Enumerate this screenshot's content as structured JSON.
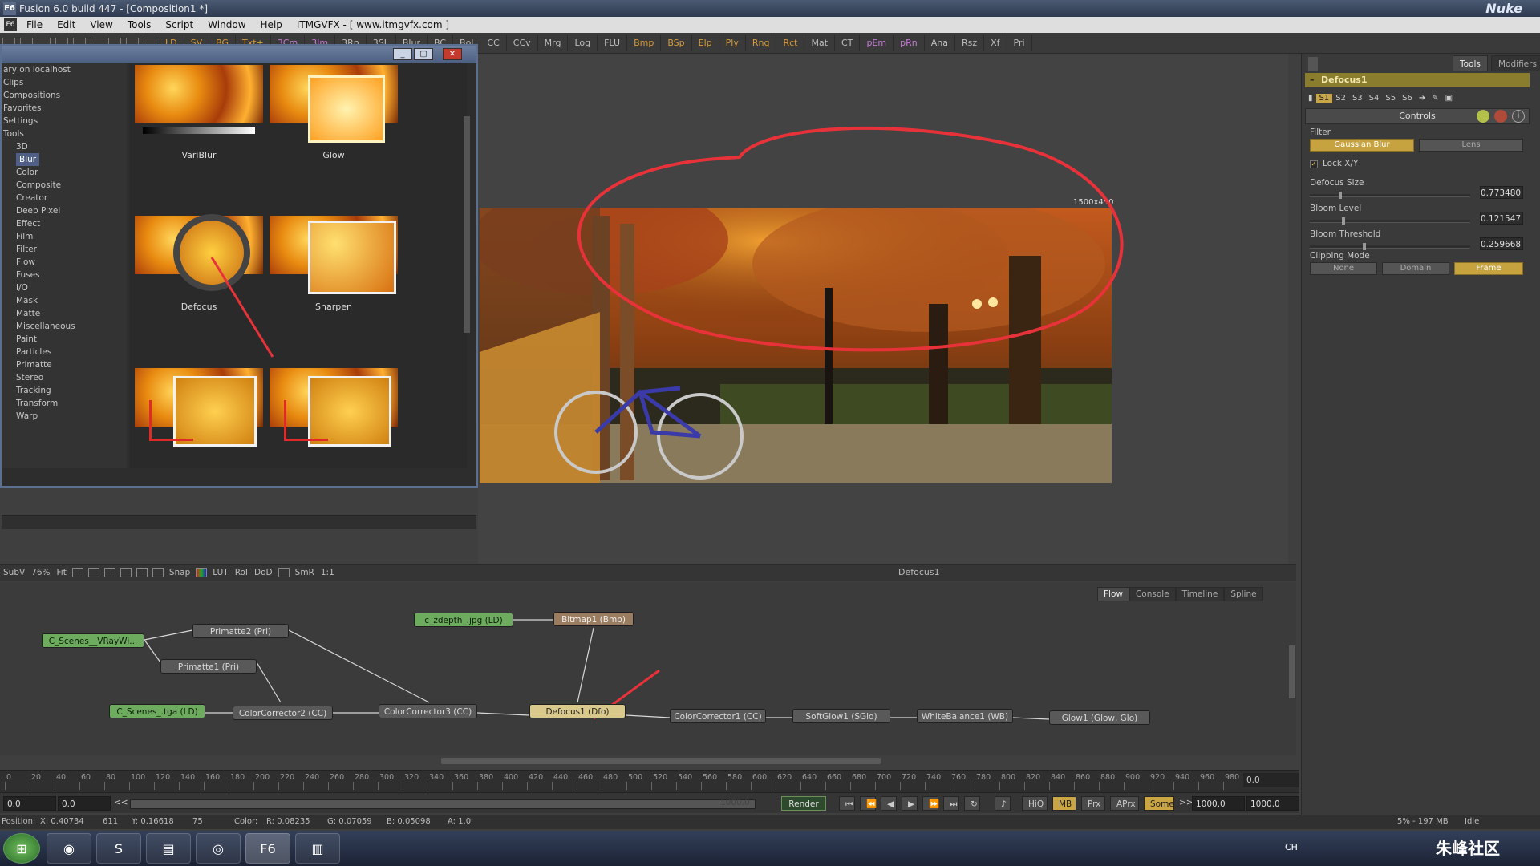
{
  "window": {
    "title": "Fusion 6.0 build 447 - [Composition1 *]",
    "app_icon": "F6",
    "logo_text": "Nuke"
  },
  "menu": {
    "icon": "F6",
    "items": [
      "File",
      "Edit",
      "View",
      "Tools",
      "Script",
      "Window",
      "Help",
      "ITMGVFX - [ www.itmgvfx.com ]"
    ]
  },
  "toolbar": {
    "buttons": [
      {
        "label": "LD",
        "color": "y"
      },
      {
        "label": "SV",
        "color": "y"
      },
      {
        "label": "BG",
        "color": "y"
      },
      {
        "label": "Txt+",
        "color": "y"
      },
      {
        "label": "3Cm",
        "color": "p"
      },
      {
        "label": "3Im",
        "color": "p"
      },
      {
        "label": "3Rn",
        "color": ""
      },
      {
        "label": "3SL",
        "color": ""
      },
      {
        "label": "Blur",
        "color": ""
      },
      {
        "label": "BC",
        "color": ""
      },
      {
        "label": "Bol",
        "color": ""
      },
      {
        "label": "CC",
        "color": ""
      },
      {
        "label": "CCv",
        "color": ""
      },
      {
        "label": "Mrg",
        "color": ""
      },
      {
        "label": "Log",
        "color": ""
      },
      {
        "label": "FLU",
        "color": ""
      },
      {
        "label": "Bmp",
        "color": "y"
      },
      {
        "label": "BSp",
        "color": "y"
      },
      {
        "label": "Elp",
        "color": "y"
      },
      {
        "label": "Ply",
        "color": "y"
      },
      {
        "label": "Rng",
        "color": "y"
      },
      {
        "label": "Rct",
        "color": "y"
      },
      {
        "label": "Mat",
        "color": ""
      },
      {
        "label": "CT",
        "color": ""
      },
      {
        "label": "pEm",
        "color": "p"
      },
      {
        "label": "pRn",
        "color": "p"
      },
      {
        "label": "Ana",
        "color": ""
      },
      {
        "label": "Rsz",
        "color": ""
      },
      {
        "label": "Xf",
        "color": ""
      },
      {
        "label": "Pri",
        "color": ""
      }
    ]
  },
  "bin": {
    "tree": [
      {
        "label": "ary on localhost",
        "indent": 0,
        "selected": false
      },
      {
        "label": "Clips",
        "indent": 0,
        "selected": false
      },
      {
        "label": "Compositions",
        "indent": 0,
        "selected": false
      },
      {
        "label": "Favorites",
        "indent": 0,
        "selected": false
      },
      {
        "label": "Settings",
        "indent": 0,
        "selected": false
      },
      {
        "label": "Tools",
        "indent": 0,
        "selected": false
      },
      {
        "label": "3D",
        "indent": 1,
        "selected": false
      },
      {
        "label": "Blur",
        "indent": 1,
        "selected": true
      },
      {
        "label": "Color",
        "indent": 1,
        "selected": false
      },
      {
        "label": "Composite",
        "indent": 1,
        "selected": false
      },
      {
        "label": "Creator",
        "indent": 1,
        "selected": false
      },
      {
        "label": "Deep Pixel",
        "indent": 1,
        "selected": false
      },
      {
        "label": "Effect",
        "indent": 1,
        "selected": false
      },
      {
        "label": "Film",
        "indent": 1,
        "selected": false
      },
      {
        "label": "Filter",
        "indent": 1,
        "selected": false
      },
      {
        "label": "Flow",
        "indent": 1,
        "selected": false
      },
      {
        "label": "Fuses",
        "indent": 1,
        "selected": false
      },
      {
        "label": "I/O",
        "indent": 1,
        "selected": false
      },
      {
        "label": "Mask",
        "indent": 1,
        "selected": false
      },
      {
        "label": "Matte",
        "indent": 1,
        "selected": false
      },
      {
        "label": "Miscellaneous",
        "indent": 1,
        "selected": false
      },
      {
        "label": "Paint",
        "indent": 1,
        "selected": false
      },
      {
        "label": "Particles",
        "indent": 1,
        "selected": false
      },
      {
        "label": "Primatte",
        "indent": 1,
        "selected": false
      },
      {
        "label": "Stereo",
        "indent": 1,
        "selected": false
      },
      {
        "label": "Tracking",
        "indent": 1,
        "selected": false
      },
      {
        "label": "Transform",
        "indent": 1,
        "selected": false
      },
      {
        "label": "Warp",
        "indent": 1,
        "selected": false
      }
    ],
    "thumbs": [
      {
        "label": "VariBlur"
      },
      {
        "label": "Glow"
      },
      {
        "label": "Defocus"
      },
      {
        "label": "Sharpen"
      },
      {
        "label": ""
      },
      {
        "label": ""
      }
    ]
  },
  "viewer": {
    "resolution": "1500x450",
    "title": "Defocus1"
  },
  "viewer_bar": {
    "items": [
      "SubV",
      "76%",
      "Fit",
      "Snap",
      "LUT",
      "RoI",
      "DoD",
      "SmR",
      "1:1"
    ]
  },
  "flow_tabs": [
    "Flow",
    "Console",
    "Timeline",
    "Spline"
  ],
  "flow_nodes": [
    {
      "label": "C_Scenes__VRayWi...",
      "style": "green"
    },
    {
      "label": "Primatte2 (Pri)",
      "style": "grey"
    },
    {
      "label": "Primatte1 (Pri)",
      "style": "grey"
    },
    {
      "label": "C_Scenes_.tga (LD)",
      "style": "green"
    },
    {
      "label": "ColorCorrector2 (CC)",
      "style": "grey"
    },
    {
      "label": "ColorCorrector3 (CC)",
      "style": "grey"
    },
    {
      "label": "c_zdepth_.jpg (LD)",
      "style": "green"
    },
    {
      "label": "Bitmap1 (Bmp)",
      "style": "bitmap"
    },
    {
      "label": "Defocus1 (Dfo)",
      "style": "defocus"
    },
    {
      "label": "ColorCorrector1 (CC)",
      "style": "grey"
    },
    {
      "label": "SoftGlow1 (SGlo)",
      "style": "grey"
    },
    {
      "label": "WhiteBalance1 (WB)",
      "style": "grey"
    },
    {
      "label": "Glow1 (Glow, Glo)",
      "style": "grey"
    }
  ],
  "timeline": {
    "ticks": [
      "0",
      "20",
      "40",
      "60",
      "80",
      "100",
      "120",
      "140",
      "160",
      "180",
      "200",
      "220",
      "240",
      "260",
      "280",
      "300",
      "320",
      "340",
      "360",
      "380",
      "400",
      "420",
      "440",
      "460",
      "480",
      "500",
      "520",
      "540",
      "560",
      "580",
      "600",
      "620",
      "640",
      "660",
      "680",
      "700",
      "720",
      "740",
      "760",
      "780",
      "800",
      "820",
      "840",
      "860",
      "880",
      "900",
      "920",
      "940",
      "960",
      "980"
    ],
    "end_field": "0.0"
  },
  "transport": {
    "start": "0.0",
    "current": "0.0",
    "rewind": "<<",
    "slider_end": "1000.0",
    "render": "Render",
    "hiq": "HiQ",
    "mb": "MB",
    "prx": "Prx",
    "aprx": "APrx",
    "some": "Some",
    "fwd": ">>",
    "end1": "1000.0",
    "end2": "1000.0"
  },
  "status": {
    "position": "Position:",
    "x": "X: 0.40734",
    "x2": "611",
    "y": "Y: 0.16618",
    "y2": "75",
    "color": "Color:",
    "r": "R: 0.08235",
    "g": "G: 0.07059",
    "b": "B: 0.05098",
    "a": "A: 1.0",
    "mem": "5% - 197 MB",
    "state": "Idle"
  },
  "inspector": {
    "tabs": [
      "Tools",
      "Modifiers"
    ],
    "tool_name": "Defocus1",
    "slots": [
      "S1",
      "S2",
      "S3",
      "S4",
      "S5",
      "S6"
    ],
    "controls_label": "Controls",
    "filter_label": "Filter",
    "filter_options": [
      "Gaussian Blur",
      "Lens"
    ],
    "lock_label": "Lock X/Y",
    "params": [
      {
        "label": "Defocus Size",
        "value": "0.773480",
        "fraction": 0.18
      },
      {
        "label": "Bloom Level",
        "value": "0.121547",
        "fraction": 0.2
      },
      {
        "label": "Bloom Threshold",
        "value": "0.259668",
        "fraction": 0.33
      }
    ],
    "clipping_label": "Clipping Mode",
    "clipping_options": [
      "None",
      "Domain",
      "Frame"
    ]
  },
  "taskbar": {
    "tray": "CH",
    "watermark": "朱峰社区"
  },
  "colors": {
    "accent": "#caa543",
    "selection": "#4f5f86",
    "annotation": "#e8323a",
    "loader_node": "#6dab5e"
  }
}
